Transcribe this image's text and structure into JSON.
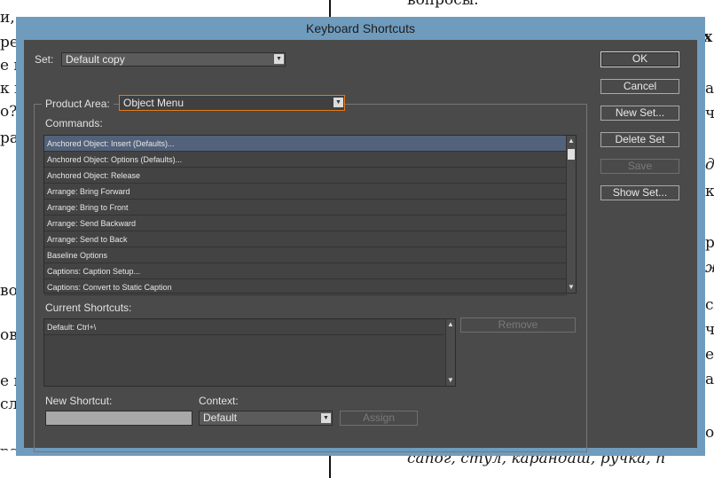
{
  "background_doc": {
    "lines": [
      {
        "id": "bg-1",
        "text": "и,"
      },
      {
        "id": "bg-2",
        "text": "ре"
      },
      {
        "id": "bg-3",
        "text": "е н"
      },
      {
        "id": "bg-4",
        "text": "к н"
      },
      {
        "id": "bg-5",
        "text": "о?"
      },
      {
        "id": "bg-6",
        "text": "ра"
      },
      {
        "id": "bg-7",
        "text": "во"
      },
      {
        "id": "bg-8",
        "text": "ов"
      },
      {
        "id": "bg-9",
        "text": "е н"
      },
      {
        "id": "bg-10",
        "text": "сло"
      },
      {
        "id": "bg-11",
        "text": "вопросы."
      },
      {
        "id": "bg-12",
        "text": "х"
      },
      {
        "id": "bg-13",
        "text": "ап"
      },
      {
        "id": "bg-14",
        "text": "ч"
      },
      {
        "id": "bg-15",
        "text": "дв"
      },
      {
        "id": "bg-16",
        "text": "кь"
      },
      {
        "id": "bg-17",
        "text": "р"
      },
      {
        "id": "bg-18",
        "text": "ж"
      },
      {
        "id": "bg-19",
        "text": "сл"
      },
      {
        "id": "bg-20",
        "text": "ч'"
      },
      {
        "id": "bg-21",
        "text": "ен"
      },
      {
        "id": "bg-22",
        "text": "аб"
      },
      {
        "id": "bg-23",
        "text": "ов"
      },
      {
        "id": "bg-24",
        "text": "сапог, стул, карандаш, ручка, п"
      },
      {
        "id": "bg-25",
        "text": "ражающих жизнь и созн"
      }
    ]
  },
  "dialog": {
    "title": "Keyboard Shortcuts",
    "set_label": "Set:",
    "set_value": "Default copy",
    "product_area_label": "Product Area:",
    "product_area_value": "Object Menu",
    "commands_label": "Commands:",
    "commands": [
      "Anchored Object: Insert (Defaults)...",
      "Anchored Object: Options (Defaults)...",
      "Anchored Object: Release",
      "Arrange: Bring Forward",
      "Arrange: Bring to Front",
      "Arrange: Send Backward",
      "Arrange: Send to Back",
      "Baseline Options",
      "Captions: Caption Setup...",
      "Captions: Convert to Static Caption"
    ],
    "current_shortcuts_label": "Current Shortcuts:",
    "current_shortcuts": [
      "Default: Ctrl+\\"
    ],
    "remove_label": "Remove",
    "new_shortcut_label": "New Shortcut:",
    "new_shortcut_value": "",
    "context_label": "Context:",
    "context_value": "Default",
    "assign_label": "Assign",
    "buttons": {
      "ok": "OK",
      "cancel": "Cancel",
      "new_set": "New Set...",
      "delete_set": "Delete Set",
      "save": "Save",
      "show_set": "Show Set..."
    },
    "colors": {
      "frame": "#6f9bbd",
      "panel": "#4a4a4a",
      "selected_row": "#52627a",
      "focus": "#e5781f"
    }
  }
}
